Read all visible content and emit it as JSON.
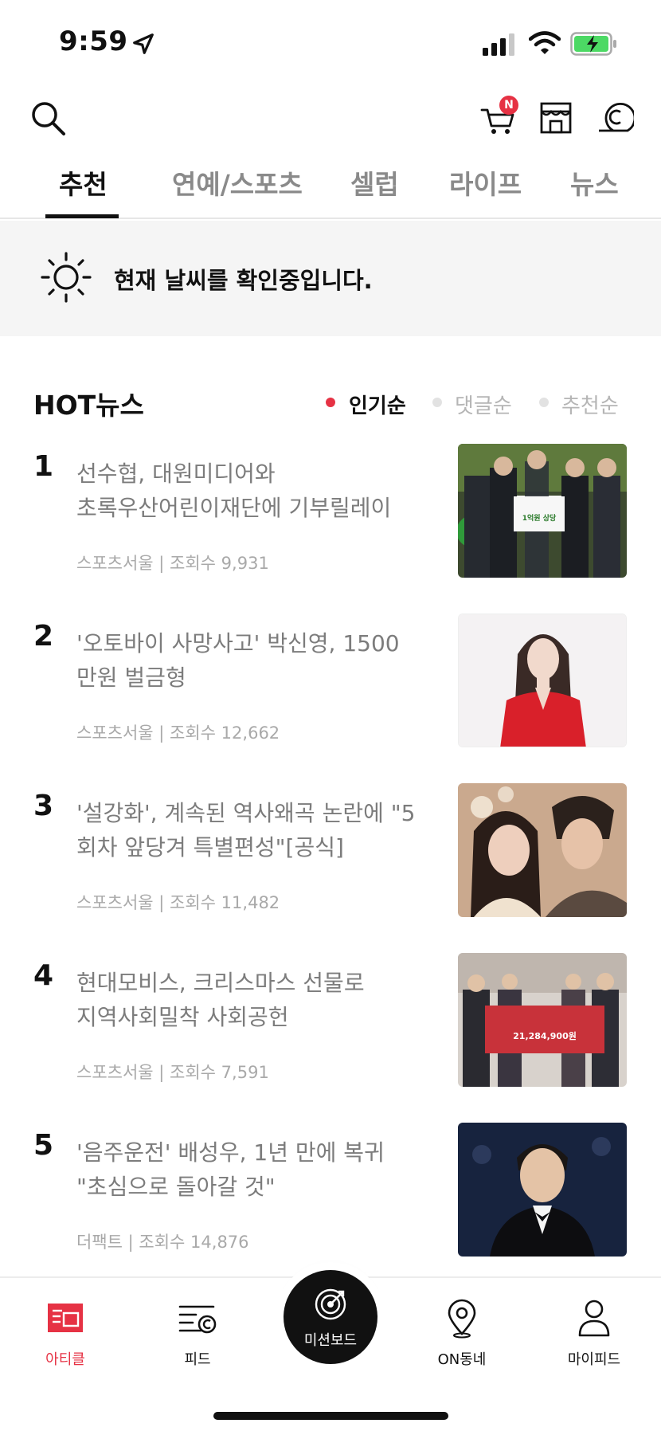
{
  "status_bar": {
    "time": "9:59"
  },
  "colors": {
    "accent": "#e63244",
    "text": "#111111",
    "muted": "#7c7c7c"
  },
  "top_bar": {
    "cart_badge": "N"
  },
  "tabs": [
    {
      "label": "추천"
    },
    {
      "label": "연예/스포츠"
    },
    {
      "label": "셀럽"
    },
    {
      "label": "라이프"
    },
    {
      "label": "뉴스"
    }
  ],
  "weather": {
    "text": "현재 날씨를 확인중입니다."
  },
  "hot_news": {
    "title": "HOT뉴스",
    "sort_options": [
      {
        "label": "인기순",
        "active": true
      },
      {
        "label": "댓글순",
        "active": false
      },
      {
        "label": "추천순",
        "active": false
      }
    ],
    "items": [
      {
        "rank": "1",
        "headline_line1": "선수협, 대원미디어와",
        "headline_line2": "초록우산어린이재단에 기부릴레이",
        "source": "스포츠서울",
        "views": "조회수 9,931",
        "thumb_text": "1억원 상당"
      },
      {
        "rank": "2",
        "headline_line1": "'오토바이 사망사고' 박신영, 1500",
        "headline_line2": "만원 벌금형",
        "source": "스포츠서울",
        "views": "조회수 12,662",
        "thumb_text": ""
      },
      {
        "rank": "3",
        "headline_line1": "'설강화', 계속된 역사왜곡 논란에 \"5",
        "headline_line2": "회차 앞당겨 특별편성\"[공식]",
        "source": "스포츠서울",
        "views": "조회수 11,482",
        "thumb_text": ""
      },
      {
        "rank": "4",
        "headline_line1": "현대모비스, 크리스마스 선물로",
        "headline_line2": "지역사회밀착 사회공헌",
        "source": "스포츠서울",
        "views": "조회수 7,591",
        "thumb_text": "21,284,900원"
      },
      {
        "rank": "5",
        "headline_line1": "'음주운전' 배성우, 1년 만에 복귀",
        "headline_line2": "\"초심으로 돌아갈 것\"",
        "source": "더팩트",
        "views": "조회수 14,876",
        "thumb_text": ""
      }
    ]
  },
  "bottom_nav": {
    "items": [
      {
        "label": "아티클",
        "icon": "article-icon",
        "active": true
      },
      {
        "label": "피드",
        "icon": "feed-icon",
        "active": false
      },
      {
        "label": "미션보드",
        "icon": "target-icon",
        "active": false
      },
      {
        "label": "ON동네",
        "icon": "location-pin-icon",
        "active": false
      },
      {
        "label": "마이피드",
        "icon": "person-icon",
        "active": false
      }
    ]
  }
}
